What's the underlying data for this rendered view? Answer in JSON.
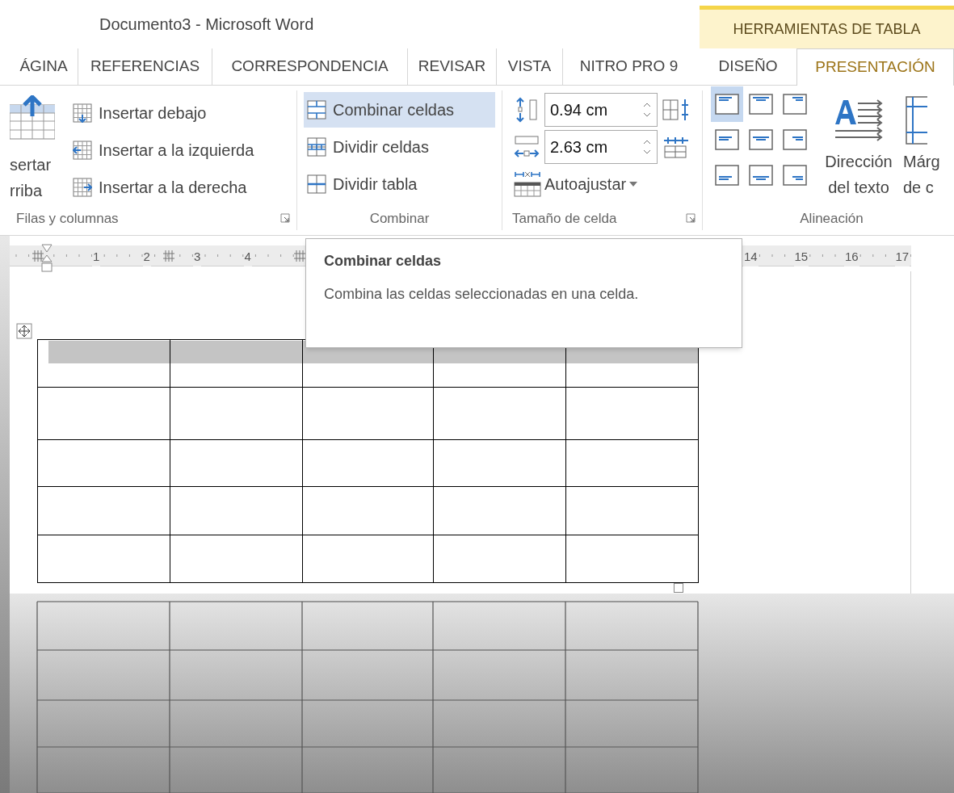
{
  "window": {
    "title": "Documento3 - Microsoft Word"
  },
  "contextual_tab_group": {
    "label": "HERRAMIENTAS DE TABLA"
  },
  "tabs": [
    {
      "label": "ÁGINA",
      "selected": false
    },
    {
      "label": "REFERENCIAS",
      "selected": false
    },
    {
      "label": "CORRESPONDENCIA",
      "selected": false
    },
    {
      "label": "REVISAR",
      "selected": false
    },
    {
      "label": "VISTA",
      "selected": false
    },
    {
      "label": "NITRO PRO 9",
      "selected": false
    }
  ],
  "contextual_tabs": [
    {
      "label": "DISEÑO",
      "selected": false
    },
    {
      "label": "PRESENTACIÓN",
      "selected": true
    }
  ],
  "ribbon": {
    "rows_columns": {
      "label": "Filas y columnas",
      "big_button": {
        "lines": [
          "sertar",
          "rriba"
        ]
      },
      "items": [
        {
          "label": "Insertar debajo",
          "highlighted": false
        },
        {
          "label": "Insertar a la izquierda",
          "highlighted": false
        },
        {
          "label": "Insertar a la derecha",
          "highlighted": false
        }
      ]
    },
    "merge": {
      "label": "Combinar",
      "items": [
        {
          "label": "Combinar celdas",
          "highlighted": true
        },
        {
          "label": "Dividir celdas",
          "highlighted": false
        },
        {
          "label": "Dividir tabla",
          "highlighted": false
        }
      ]
    },
    "cell_size": {
      "label": "Tamaño de celda",
      "height": "0.94 cm",
      "width": "2.63 cm",
      "autofit": "Autoajustar"
    },
    "alignment": {
      "label": "Alineación",
      "buttons": [
        {
          "selected": true
        },
        {
          "selected": false
        },
        {
          "selected": false
        },
        {
          "selected": false
        },
        {
          "selected": false
        },
        {
          "selected": false
        },
        {
          "selected": false
        },
        {
          "selected": false
        },
        {
          "selected": false
        }
      ],
      "text_direction": [
        "Dirección",
        "del texto"
      ],
      "margins": [
        "Márg",
        "de c"
      ]
    }
  },
  "ruler": {
    "left_labels": [
      "1",
      "2",
      "3",
      "4"
    ],
    "right_labels": [
      "14",
      "15",
      "16",
      "17"
    ]
  },
  "tooltip": {
    "title": "Combinar celdas",
    "text": "Combina las celdas seleccionadas en una celda."
  },
  "table": {
    "rows": [
      {
        "selected": true
      },
      {
        "selected": false
      },
      {
        "selected": false
      },
      {
        "selected": false
      },
      {
        "selected": false
      }
    ]
  }
}
